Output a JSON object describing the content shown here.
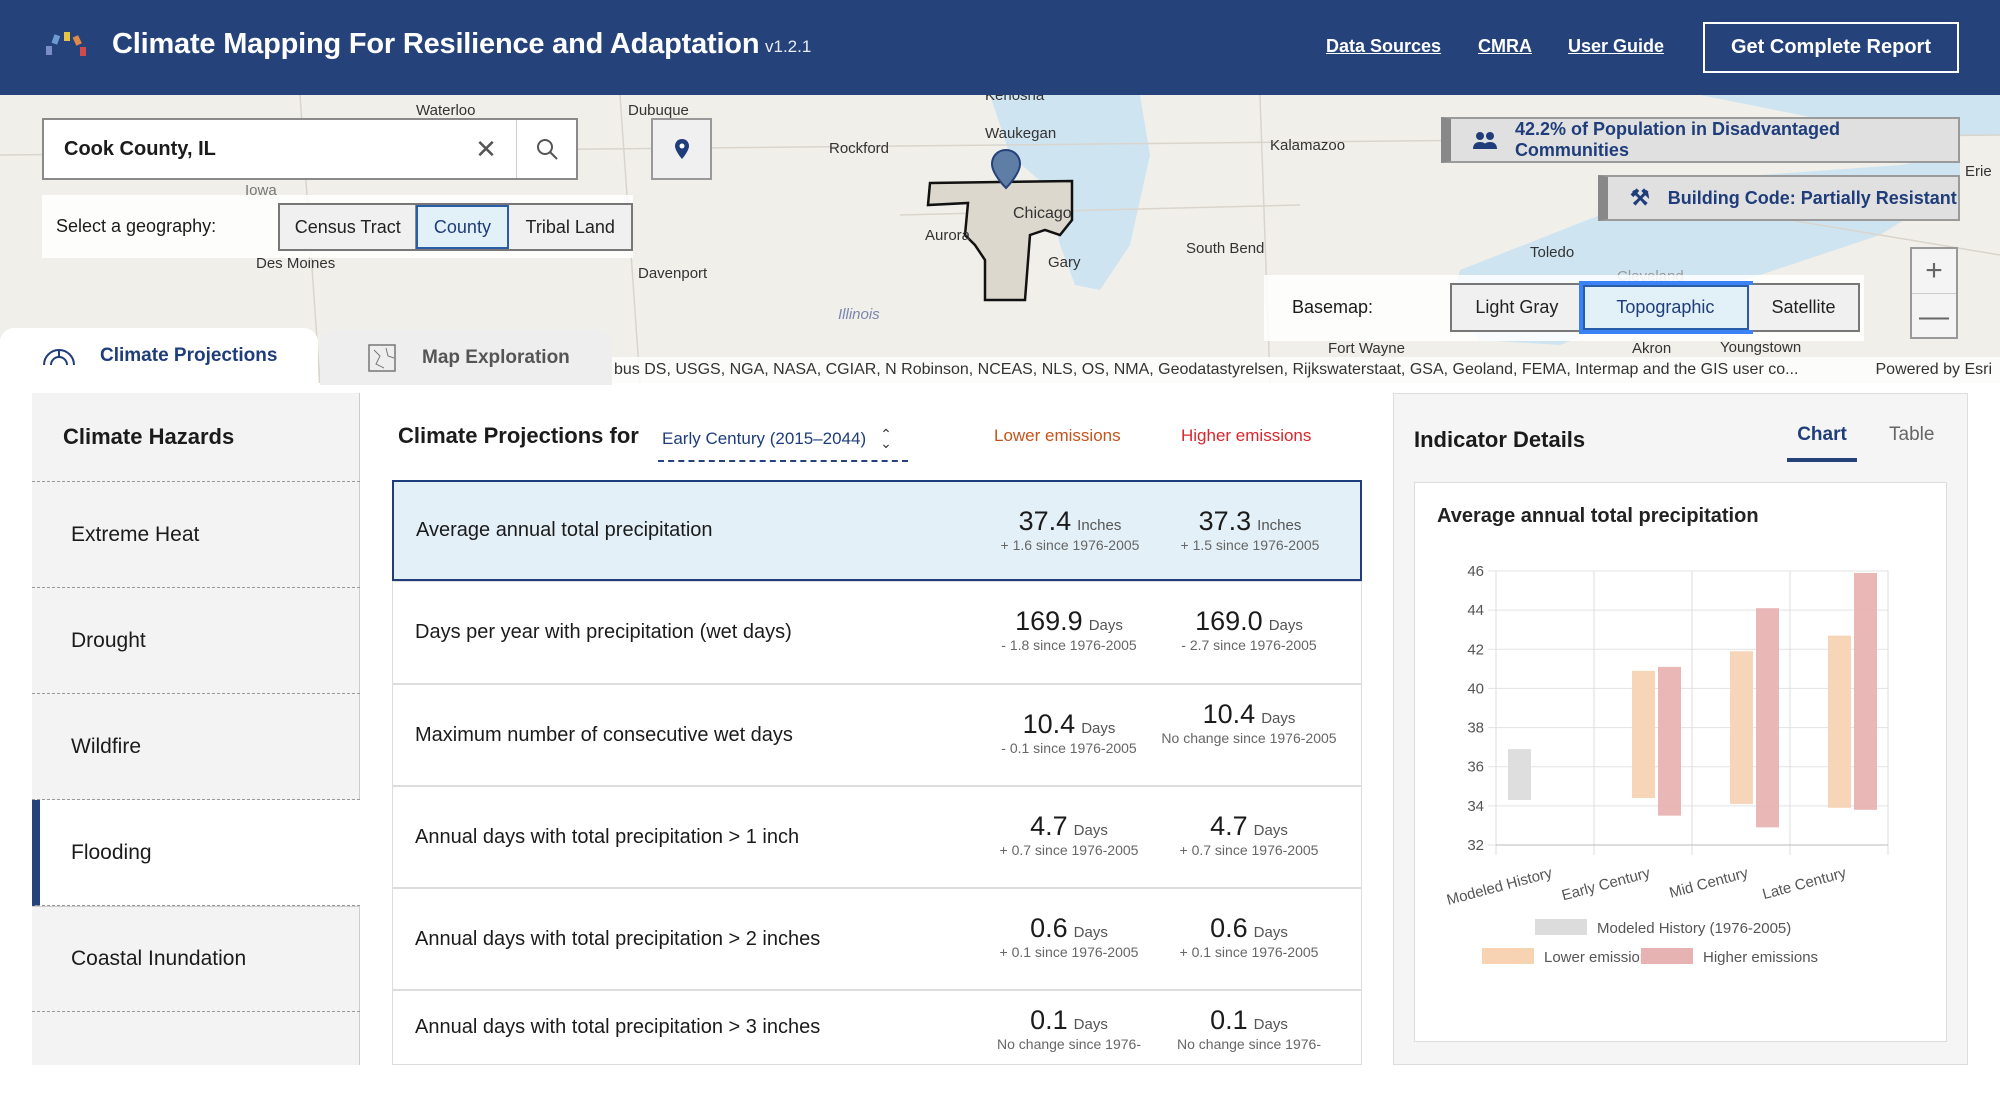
{
  "header": {
    "title": "Climate Mapping For Resilience and Adaptation",
    "version": "v1.2.1",
    "links": [
      "Data Sources",
      "CMRA",
      "User Guide"
    ],
    "report_button": "Get Complete Report",
    "bg_color": "#25427b"
  },
  "map": {
    "search": {
      "value": "Cook County, IL"
    },
    "geography": {
      "label": "Select a geography:",
      "options": [
        "Census Tract",
        "County",
        "Tribal Land"
      ],
      "selected": "County"
    },
    "badges": {
      "population": "42.2% of Population in Disadvantaged Communities",
      "building_code": "Building Code: Partially Resistant"
    },
    "basemap": {
      "label": "Basemap:",
      "options": [
        "Light Gray",
        "Topographic",
        "Satellite"
      ],
      "selected": "Topographic"
    },
    "zoom": {
      "in": "+",
      "out": "—"
    },
    "attribution": "bus DS, USGS, NGA, NASA, CGIAR, N Robinson, NCEAS, NLS, OS, NMA, Geodatastyrelsen, Rijkswaterstaat, GSA, Geoland, FEMA, Intermap and the GIS user co...",
    "powered": "Powered by Esri",
    "labels": [
      "Waterloo",
      "Dubuque",
      "Rockford",
      "Waukegan",
      "Kalamazoo",
      "Chicago",
      "Aurora",
      "Gary",
      "South Bend",
      "Toledo",
      "Des Moines",
      "Davenport",
      "Illinois",
      "Iowa",
      "Fort Wayne",
      "Akron",
      "Youngstown",
      "Erie",
      "Cleveland",
      "Kenosha"
    ]
  },
  "tabs": [
    {
      "label": "Climate Projections",
      "icon": "gauge-icon"
    },
    {
      "label": "Map Exploration",
      "icon": "map-icon"
    }
  ],
  "sidebar": {
    "title": "Climate Hazards",
    "items": [
      "Extreme Heat",
      "Drought",
      "Wildfire",
      "Flooding",
      "Coastal Inundation"
    ],
    "selected": "Flooding"
  },
  "projections": {
    "title": "Climate Projections for",
    "period": "Early Century (2015–2044)",
    "lower_label": "Lower emissions",
    "higher_label": "Higher emissions",
    "lower_color": "#c4541c",
    "higher_color": "#d9262c",
    "rows": [
      {
        "label": "Average annual total precipitation",
        "lower": {
          "value": "37.4",
          "unit": "Inches",
          "change": "+ 1.6 since 1976-2005"
        },
        "higher": {
          "value": "37.3",
          "unit": "Inches",
          "change": "+ 1.5 since 1976-2005"
        }
      },
      {
        "label": "Days per year with precipitation (wet days)",
        "lower": {
          "value": "169.9",
          "unit": "Days",
          "change": "- 1.8 since 1976-2005"
        },
        "higher": {
          "value": "169.0",
          "unit": "Days",
          "change": "- 2.7 since 1976-2005"
        }
      },
      {
        "label": "Maximum number of consecutive wet days",
        "lower": {
          "value": "10.4",
          "unit": "Days",
          "change": "- 0.1 since 1976-2005"
        },
        "higher": {
          "value": "10.4",
          "unit": "Days",
          "change": "No change since 1976-2005"
        }
      },
      {
        "label": "Annual days with total precipitation > 1 inch",
        "lower": {
          "value": "4.7",
          "unit": "Days",
          "change": "+ 0.7 since 1976-2005"
        },
        "higher": {
          "value": "4.7",
          "unit": "Days",
          "change": "+ 0.7 since 1976-2005"
        }
      },
      {
        "label": "Annual days with total precipitation > 2 inches",
        "lower": {
          "value": "0.6",
          "unit": "Days",
          "change": "+ 0.1 since 1976-2005"
        },
        "higher": {
          "value": "0.6",
          "unit": "Days",
          "change": "+ 0.1 since 1976-2005"
        }
      },
      {
        "label": "Annual days with total precipitation > 3 inches",
        "lower": {
          "value": "0.1",
          "unit": "Days",
          "change": "No change since 1976-"
        },
        "higher": {
          "value": "0.1",
          "unit": "Days",
          "change": "No change since 1976-"
        }
      }
    ]
  },
  "details": {
    "title": "Indicator Details",
    "tabs": [
      "Chart",
      "Table"
    ],
    "selected_tab": "Chart"
  },
  "chart_data": {
    "type": "bar",
    "title": "Average annual total precipitation",
    "categories": [
      "Modeled History",
      "Early Century",
      "Mid Century",
      "Late Century"
    ],
    "ylim": [
      32,
      46
    ],
    "yticks": [
      32,
      34,
      36,
      38,
      40,
      42,
      44,
      46
    ],
    "grid": true,
    "legend": "bottom",
    "series": [
      {
        "name": "Modeled History (1976-2005)",
        "color": "#dcdcdd",
        "ranges": [
          [
            34.3,
            36.9
          ],
          null,
          null,
          null
        ]
      },
      {
        "name": "Lower emissions",
        "color": "#f7d3b4",
        "ranges": [
          null,
          [
            34.4,
            40.9
          ],
          [
            34.1,
            41.9
          ],
          [
            33.9,
            42.7
          ]
        ]
      },
      {
        "name": "Higher emissions",
        "color": "#e7b3b2",
        "ranges": [
          null,
          [
            33.5,
            41.1
          ],
          [
            32.9,
            44.1
          ],
          [
            33.8,
            45.9
          ]
        ]
      }
    ]
  }
}
